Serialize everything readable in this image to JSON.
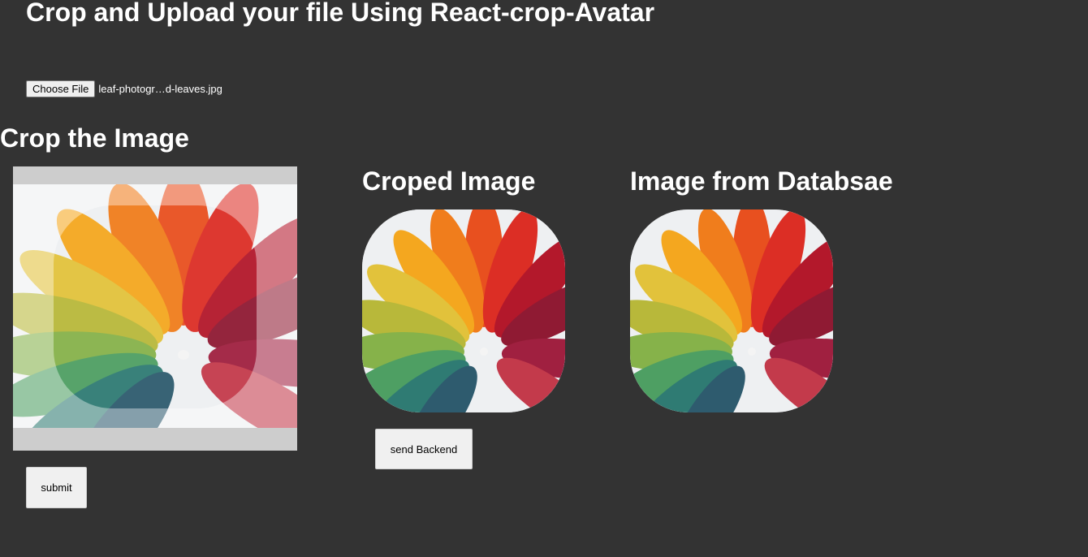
{
  "page": {
    "title": "Crop and Upload your file Using React-crop-Avatar",
    "crop_heading": "Crop the Image",
    "cropped_heading": "Croped Image",
    "db_heading": "Image from Databsae"
  },
  "file_input": {
    "button_label": "Choose File",
    "file_name": "leaf-photogr…d-leaves.jpg"
  },
  "buttons": {
    "send_backend": "send Backend",
    "submit": "submit"
  },
  "colors": {
    "background": "#333333",
    "editor_frame": "#aaaaaa",
    "button_bg": "#f0f0f0"
  },
  "images": {
    "subject": "leaf-icon"
  }
}
